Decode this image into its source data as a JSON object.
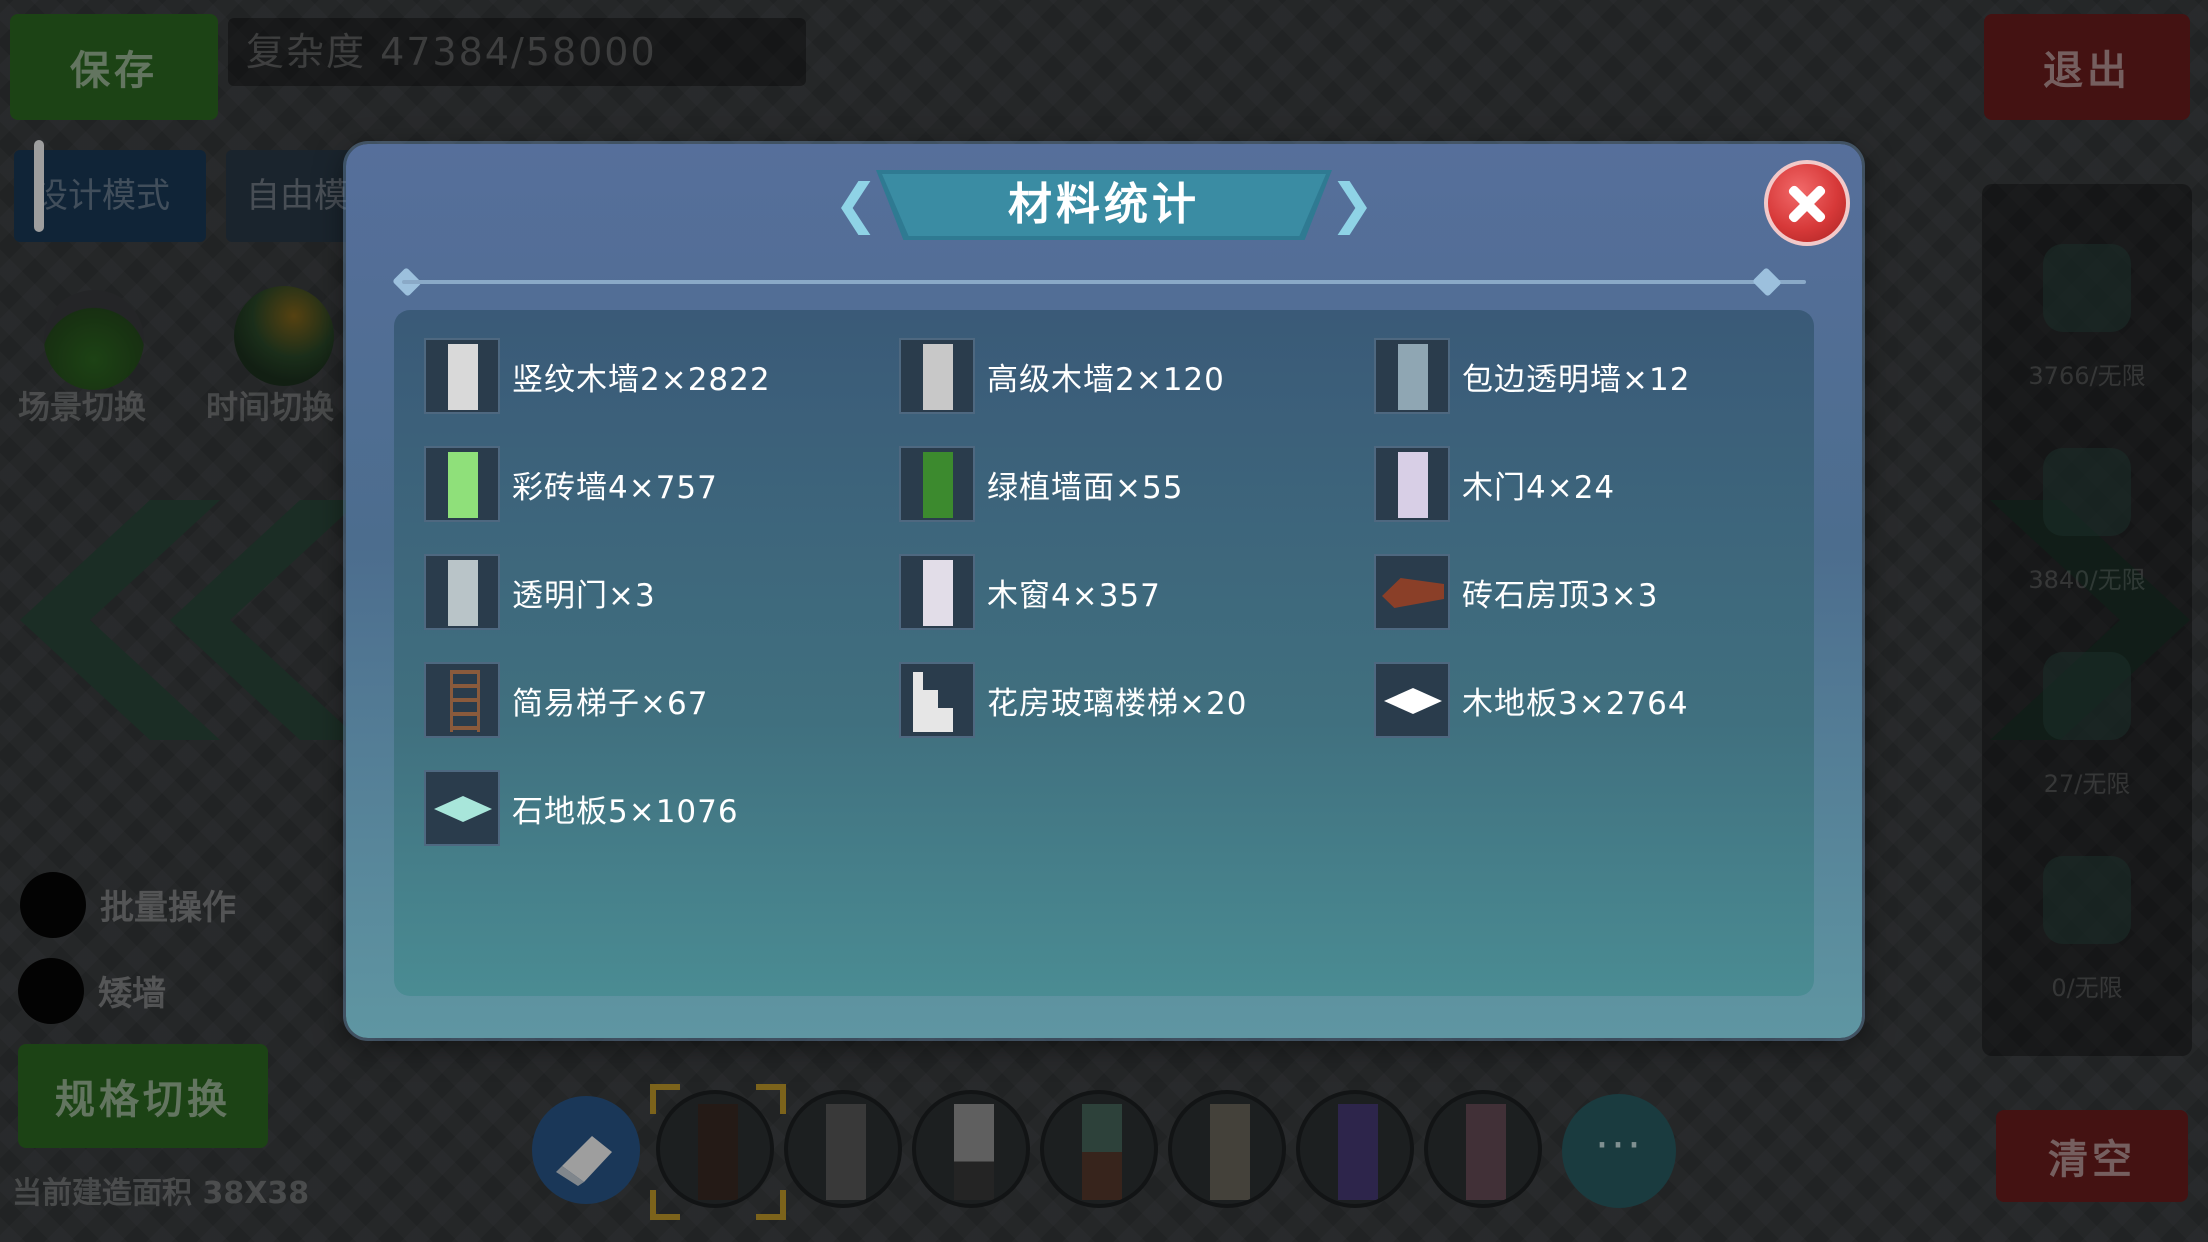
{
  "hud": {
    "save_label": "保存",
    "complexity_text": "复杂度 47384/58000",
    "exit_label": "退出",
    "mode_design": "设计模式",
    "mode_free": "自由模",
    "scene_switch": "场景切换",
    "time_switch": "时间切换",
    "batch_label": "批量操作",
    "low_wall_label": "矮墙",
    "spec_switch_label": "规格切换",
    "build_area": "当前建造面积 38X38",
    "clear_label": "清空",
    "more_label": "···"
  },
  "right_panel": {
    "items": [
      {
        "count": "3766/无限"
      },
      {
        "count": "3840/无限"
      },
      {
        "count": "27/无限"
      },
      {
        "count": "0/无限"
      }
    ]
  },
  "modal": {
    "title": "材料统计",
    "materials": [
      {
        "label": "竖纹木墙2×2822",
        "icon": "vertical-wood-wall-icon",
        "color": "#d9d9d9"
      },
      {
        "label": "高级木墙2×120",
        "icon": "premium-wood-wall-icon",
        "color": "#c8c8c8"
      },
      {
        "label": "包边透明墙×12",
        "icon": "edged-glass-wall-icon",
        "color": "#8fa6b3"
      },
      {
        "label": "彩砖墙4×757",
        "icon": "color-brick-wall-icon",
        "color": "#8fe07a"
      },
      {
        "label": "绿植墙面×55",
        "icon": "green-plant-wall-icon",
        "color": "#3c8a2e"
      },
      {
        "label": "木门4×24",
        "icon": "wood-door-icon",
        "color": "#d8cfe6"
      },
      {
        "label": "透明门×3",
        "icon": "glass-door-icon",
        "color": "#b9c4c8"
      },
      {
        "label": "木窗4×357",
        "icon": "wood-window-icon",
        "color": "#e2dde8"
      },
      {
        "label": "砖石房顶3×3",
        "icon": "brick-roof-icon",
        "color": "#8a3f28"
      },
      {
        "label": "简易梯子×67",
        "icon": "simple-ladder-icon",
        "color": "#8a5a3c"
      },
      {
        "label": "花房玻璃楼梯×20",
        "icon": "greenhouse-glass-stairs-icon",
        "color": "#e6e6e6"
      },
      {
        "label": "木地板3×2764",
        "icon": "wood-floor-icon",
        "color": "#ffffff"
      },
      {
        "label": "石地板5×1076",
        "icon": "stone-floor-icon",
        "color": "#a8e6da"
      }
    ]
  }
}
